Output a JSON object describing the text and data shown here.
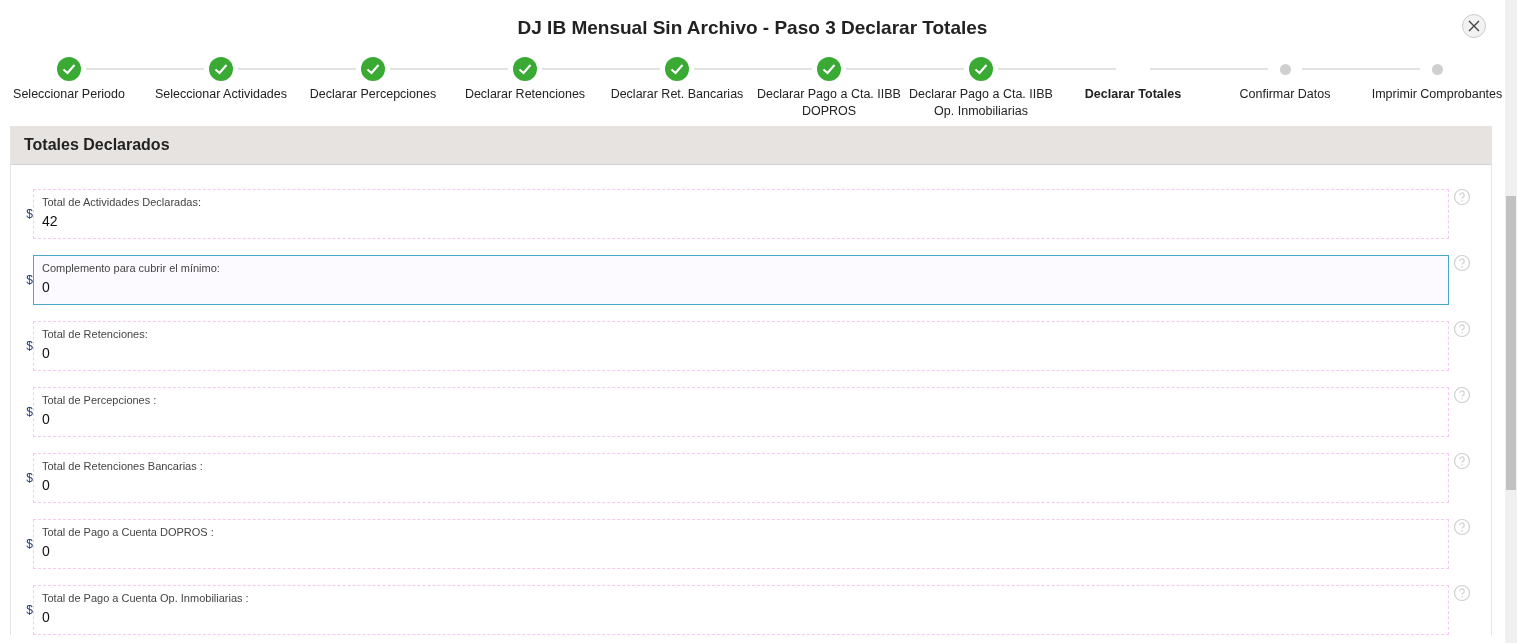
{
  "dialog": {
    "title": "DJ IB Mensual Sin Archivo - Paso 3 Declarar Totales"
  },
  "steps": [
    {
      "label": "Seleccionar Periodo",
      "completed": true,
      "selected": false
    },
    {
      "label": "Seleccionar Actividades",
      "completed": true,
      "selected": false
    },
    {
      "label": "Declarar Percepciones",
      "completed": true,
      "selected": false
    },
    {
      "label": "Declarar Retenciones",
      "completed": true,
      "selected": false
    },
    {
      "label": "Declarar Ret. Bancarias",
      "completed": true,
      "selected": false
    },
    {
      "label": "Declarar Pago a Cta. IIBB DOPROS",
      "completed": true,
      "selected": false
    },
    {
      "label": "Declarar Pago a Cta. IIBB Op. Inmobiliarias",
      "completed": true,
      "selected": false
    },
    {
      "label": "Declarar Totales",
      "completed": false,
      "selected": true
    },
    {
      "label": "Confirmar Datos",
      "completed": false,
      "selected": false
    },
    {
      "label": "Imprimir Comprobantes",
      "completed": false,
      "selected": false
    }
  ],
  "panel": {
    "title": "Totales Declarados",
    "fields": [
      {
        "currency": "$",
        "label": "Total de Actividades Declaradas:",
        "value": "42",
        "focused": false
      },
      {
        "currency": "$",
        "label": "Complemento para cubrir el mínimo:",
        "value": "0",
        "focused": true
      },
      {
        "currency": "$",
        "label": "Total de Retenciones:",
        "value": "0",
        "focused": false
      },
      {
        "currency": "$",
        "label": "Total de Percepciones :",
        "value": "0",
        "focused": false
      },
      {
        "currency": "$",
        "label": "Total de Retenciones Bancarias :",
        "value": "0",
        "focused": false
      },
      {
        "currency": "$",
        "label": "Total de Pago a Cuenta DOPROS :",
        "value": "0",
        "focused": false
      },
      {
        "currency": "$",
        "label": "Total de Pago a Cuenta Op. Inmobiliarias :",
        "value": "0",
        "focused": false
      }
    ]
  }
}
